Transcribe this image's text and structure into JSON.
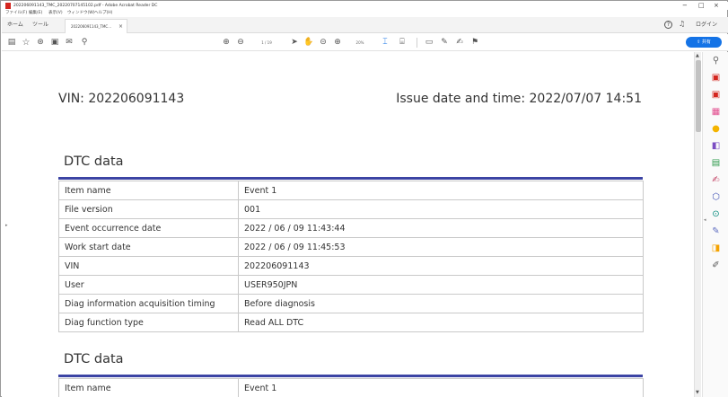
{
  "window": {
    "title": "202206091143_TMC_20220707145102.pdf - Adobe Acrobat Reader DC",
    "controls": {
      "minimize": "−",
      "restore": "□",
      "close": "×"
    }
  },
  "menubar": {
    "items": [
      "ファイル(F)",
      "編集(E)",
      "表示(V)",
      "ウィンドウ(W)",
      "ヘルプ(H)"
    ]
  },
  "tabbar": {
    "home": "ホーム",
    "tools": "ツール",
    "doc_tab_label": "202206091143_TMC...",
    "doc_tab_close": "×",
    "signin": "ログイン"
  },
  "toolbar": {
    "page_indicator": "1 / 19",
    "zoom": "20%",
    "share_label": "共有"
  },
  "document": {
    "vin_line": "VIN: 202206091143",
    "issue_line": "Issue date and time: 2022/07/07 14:51",
    "sections": [
      {
        "title": "DTC data",
        "rows": [
          {
            "key": "Item name",
            "value": "Event 1"
          },
          {
            "key": "File version",
            "value": "001"
          },
          {
            "key": "Event occurrence date",
            "value": "2022 / 06 / 09 11:43:44"
          },
          {
            "key": "Work start date",
            "value": "2022 / 06 / 09 11:45:53"
          },
          {
            "key": "VIN",
            "value": "202206091143"
          },
          {
            "key": "User",
            "value": "USER950JPN"
          },
          {
            "key": "Diag information acquisition timing",
            "value": "Before diagnosis"
          },
          {
            "key": "Diag function type",
            "value": "Read ALL DTC"
          }
        ]
      },
      {
        "title": "DTC data",
        "rows": [
          {
            "key": "Item name",
            "value": "Event 1"
          }
        ]
      }
    ]
  },
  "colors": {
    "accent_rule": "#3c44a4",
    "share_button": "#1473e6",
    "app_icon": "#d4261f"
  },
  "right_pane_icons": [
    "zoom-search-icon",
    "create-pdf-icon",
    "export-pdf-icon",
    "organize-pages-icon",
    "comment-icon",
    "combine-files-icon",
    "edit-pdf-icon",
    "fill-sign-icon",
    "protect-icon",
    "scan-icon",
    "more-tools-icon",
    "send-for-review-icon",
    "measure-icon"
  ]
}
